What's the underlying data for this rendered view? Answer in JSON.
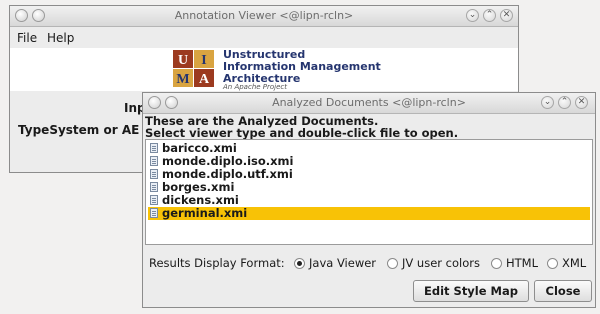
{
  "back_window": {
    "title": "Annotation Viewer <@lipn-rcln>",
    "menu": [
      "File",
      "Help"
    ],
    "logo_lines": [
      "Unstructured",
      "Information Management",
      "Architecture"
    ],
    "logo_tagline": "An Apache Project",
    "logo_letters": [
      "U",
      "I",
      "M",
      "A"
    ],
    "label_input": "Inp",
    "label_typesystem": "TypeSystem or AE De"
  },
  "dialog": {
    "title": "Analyzed Documents <@lipn-rcln>",
    "line1": "These are the Analyzed Documents.",
    "line2": "Select viewer type and double-click file to open.",
    "files": [
      "baricco.xmi",
      "monde.diplo.iso.xmi",
      "monde.diplo.utf.xmi",
      "borges.xmi",
      "dickens.xmi",
      "germinal.xmi"
    ],
    "selected_index": 5,
    "format_label": "Results Display Format:",
    "options": [
      "Java Viewer",
      "JV user colors",
      "HTML",
      "XML"
    ],
    "selected_option": "Java Viewer",
    "btn_edit": "Edit Style Map",
    "btn_close": "Close"
  },
  "colors": {
    "selection": "#f8c206",
    "logo_navy": "#25356f",
    "logo_brown": "#9c3a1f",
    "logo_tan": "#d9a441"
  }
}
